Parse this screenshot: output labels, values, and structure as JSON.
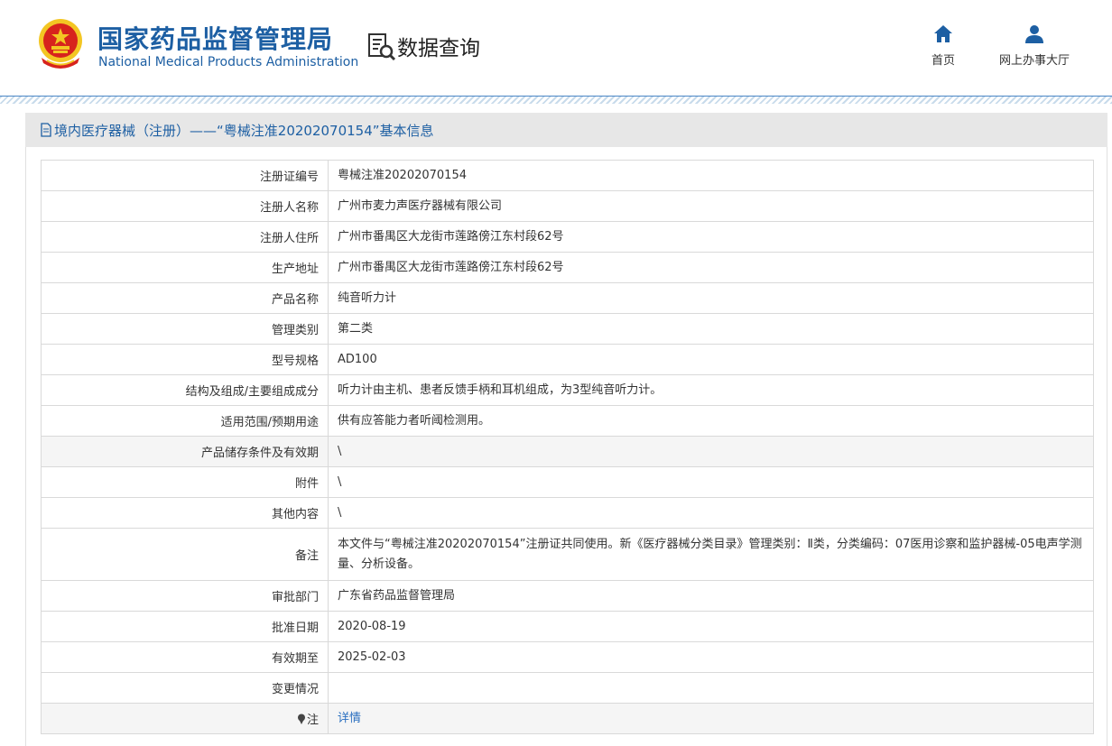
{
  "header": {
    "org_cn": "国家药品监督管理局",
    "org_en": "National Medical Products Administration",
    "query_label": "数据查询",
    "nav": [
      {
        "label": "首页",
        "icon": "home-icon"
      },
      {
        "label": "网上办事大厅",
        "icon": "user-icon"
      }
    ]
  },
  "panel": {
    "title": "境内医疗器械（注册）——“粤械注准20202070154”基本信息"
  },
  "rows": [
    {
      "label": "注册证编号",
      "value": "粤械注准20202070154"
    },
    {
      "label": "注册人名称",
      "value": "广州市麦力声医疗器械有限公司"
    },
    {
      "label": "注册人住所",
      "value": "广州市番禺区大龙街市莲路傍江东村段62号"
    },
    {
      "label": "生产地址",
      "value": "广州市番禺区大龙街市莲路傍江东村段62号"
    },
    {
      "label": "产品名称",
      "value": "纯音听力计"
    },
    {
      "label": "管理类别",
      "value": "第二类"
    },
    {
      "label": "型号规格",
      "value": "AD100"
    },
    {
      "label": "结构及组成/主要组成成分",
      "value": "听力计由主机、患者反馈手柄和耳机组成，为3型纯音听力计。"
    },
    {
      "label": "适用范围/预期用途",
      "value": "供有应答能力者听阈检测用。"
    },
    {
      "label": "产品储存条件及有效期",
      "value": "\\"
    },
    {
      "label": "附件",
      "value": "\\"
    },
    {
      "label": "其他内容",
      "value": "\\"
    },
    {
      "label": "备注",
      "value": "本文件与“粤械注准20202070154”注册证共同使用。新《医疗器械分类目录》管理类别：Ⅱ类，分类编码：07医用诊察和监护器械-05电声学测量、分析设备。"
    },
    {
      "label": "审批部门",
      "value": "广东省药品监督管理局"
    },
    {
      "label": "批准日期",
      "value": "2020-08-19"
    },
    {
      "label": "有效期至",
      "value": "2025-02-03"
    },
    {
      "label": "变更情况",
      "value": ""
    },
    {
      "label": "注",
      "value": "详情"
    }
  ],
  "colors": {
    "brand_blue": "#1d5fa3",
    "link_blue": "#2a6fc0",
    "emblem_red": "#d7231d",
    "emblem_gold": "#f3c623"
  }
}
